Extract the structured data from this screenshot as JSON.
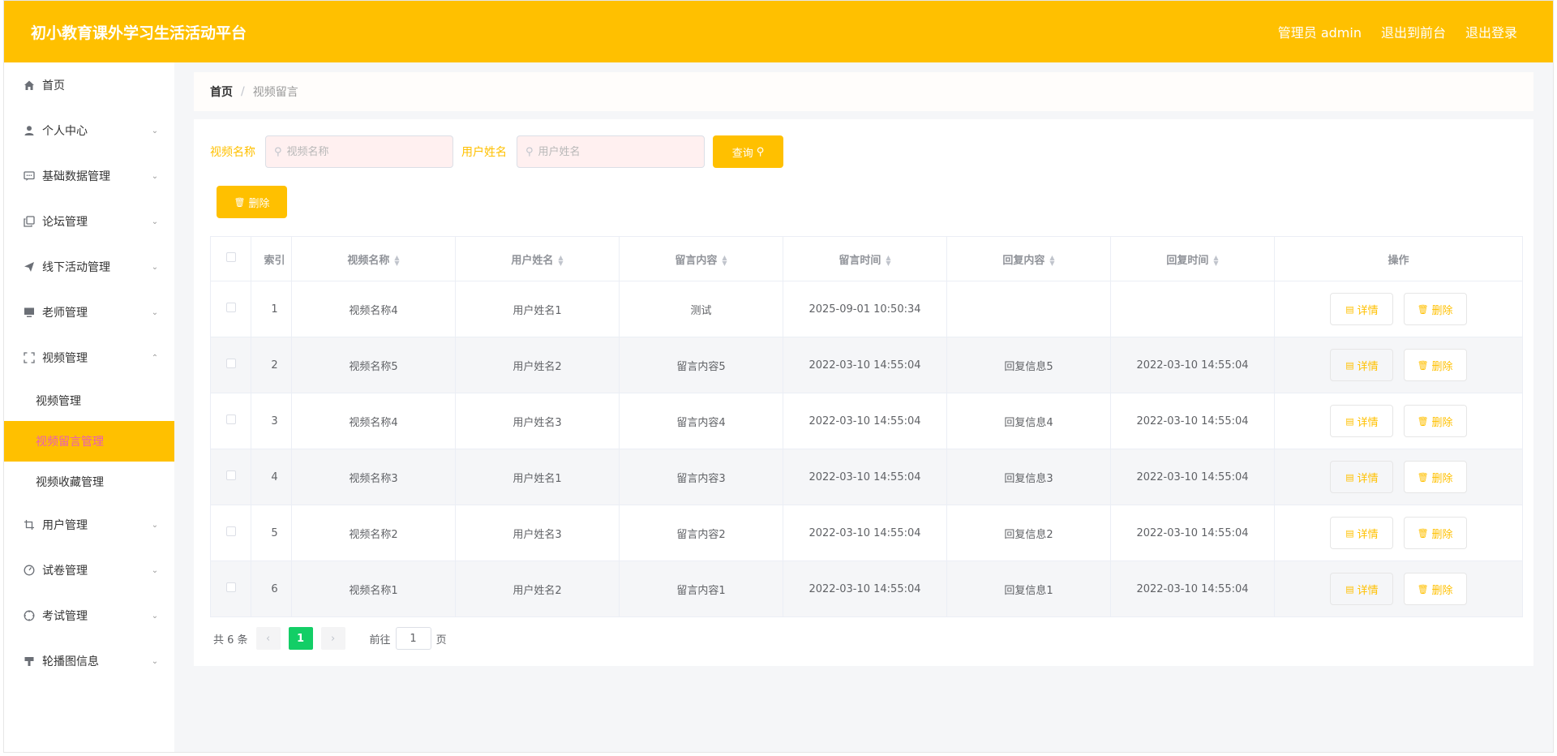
{
  "header": {
    "title": "初小教育课外学习生活活动平台",
    "admin_label": "管理员 admin",
    "to_front": "退出到前台",
    "logout": "退出登录"
  },
  "sidebar": {
    "items": [
      {
        "label": "首页",
        "icon": "home-icon"
      },
      {
        "label": "个人中心",
        "icon": "user-icon"
      },
      {
        "label": "基础数据管理",
        "icon": "chat-icon"
      },
      {
        "label": "论坛管理",
        "icon": "copy-icon"
      },
      {
        "label": "线下活动管理",
        "icon": "send-icon"
      },
      {
        "label": "老师管理",
        "icon": "monitor-icon"
      },
      {
        "label": "视频管理",
        "icon": "fullscreen-icon"
      },
      {
        "label": "用户管理",
        "icon": "crop-icon"
      },
      {
        "label": "试卷管理",
        "icon": "odometer-icon"
      },
      {
        "label": "考试管理",
        "icon": "compass-icon"
      },
      {
        "label": "轮播图信息",
        "icon": "stamp-icon"
      }
    ],
    "video_sub": [
      "视频管理",
      "视频留言管理",
      "视频收藏管理"
    ]
  },
  "breadcrumb": {
    "home": "首页",
    "sep": "/",
    "current": "视频留言"
  },
  "search": {
    "video_label": "视频名称",
    "video_placeholder": "视频名称",
    "user_label": "用户姓名",
    "user_placeholder": "用户姓名",
    "query_button": "查询",
    "delete_button": "删除"
  },
  "table": {
    "headers": [
      "索引",
      "视频名称",
      "用户姓名",
      "留言内容",
      "留言时间",
      "回复内容",
      "回复时间",
      "操作"
    ],
    "rows": [
      {
        "index": "1",
        "video": "视频名称4",
        "user": "用户姓名1",
        "content": "测试",
        "time": "2025-09-01 10:50:34",
        "reply": "",
        "reply_time": ""
      },
      {
        "index": "2",
        "video": "视频名称5",
        "user": "用户姓名2",
        "content": "留言内容5",
        "time": "2022-03-10 14:55:04",
        "reply": "回复信息5",
        "reply_time": "2022-03-10 14:55:04"
      },
      {
        "index": "3",
        "video": "视频名称4",
        "user": "用户姓名3",
        "content": "留言内容4",
        "time": "2022-03-10 14:55:04",
        "reply": "回复信息4",
        "reply_time": "2022-03-10 14:55:04"
      },
      {
        "index": "4",
        "video": "视频名称3",
        "user": "用户姓名1",
        "content": "留言内容3",
        "time": "2022-03-10 14:55:04",
        "reply": "回复信息3",
        "reply_time": "2022-03-10 14:55:04"
      },
      {
        "index": "5",
        "video": "视频名称2",
        "user": "用户姓名3",
        "content": "留言内容2",
        "time": "2022-03-10 14:55:04",
        "reply": "回复信息2",
        "reply_time": "2022-03-10 14:55:04"
      },
      {
        "index": "6",
        "video": "视频名称1",
        "user": "用户姓名2",
        "content": "留言内容1",
        "time": "2022-03-10 14:55:04",
        "reply": "回复信息1",
        "reply_time": "2022-03-10 14:55:04"
      }
    ],
    "detail_button": "详情",
    "delete_button": "删除"
  },
  "pager": {
    "total": "共 6 条",
    "current": "1",
    "goto_prefix": "前往",
    "goto_value": "1",
    "goto_suffix": "页"
  },
  "colors": {
    "accent": "#ffc000",
    "active_text": "#ea5db8",
    "page_active": "#13ce66"
  }
}
